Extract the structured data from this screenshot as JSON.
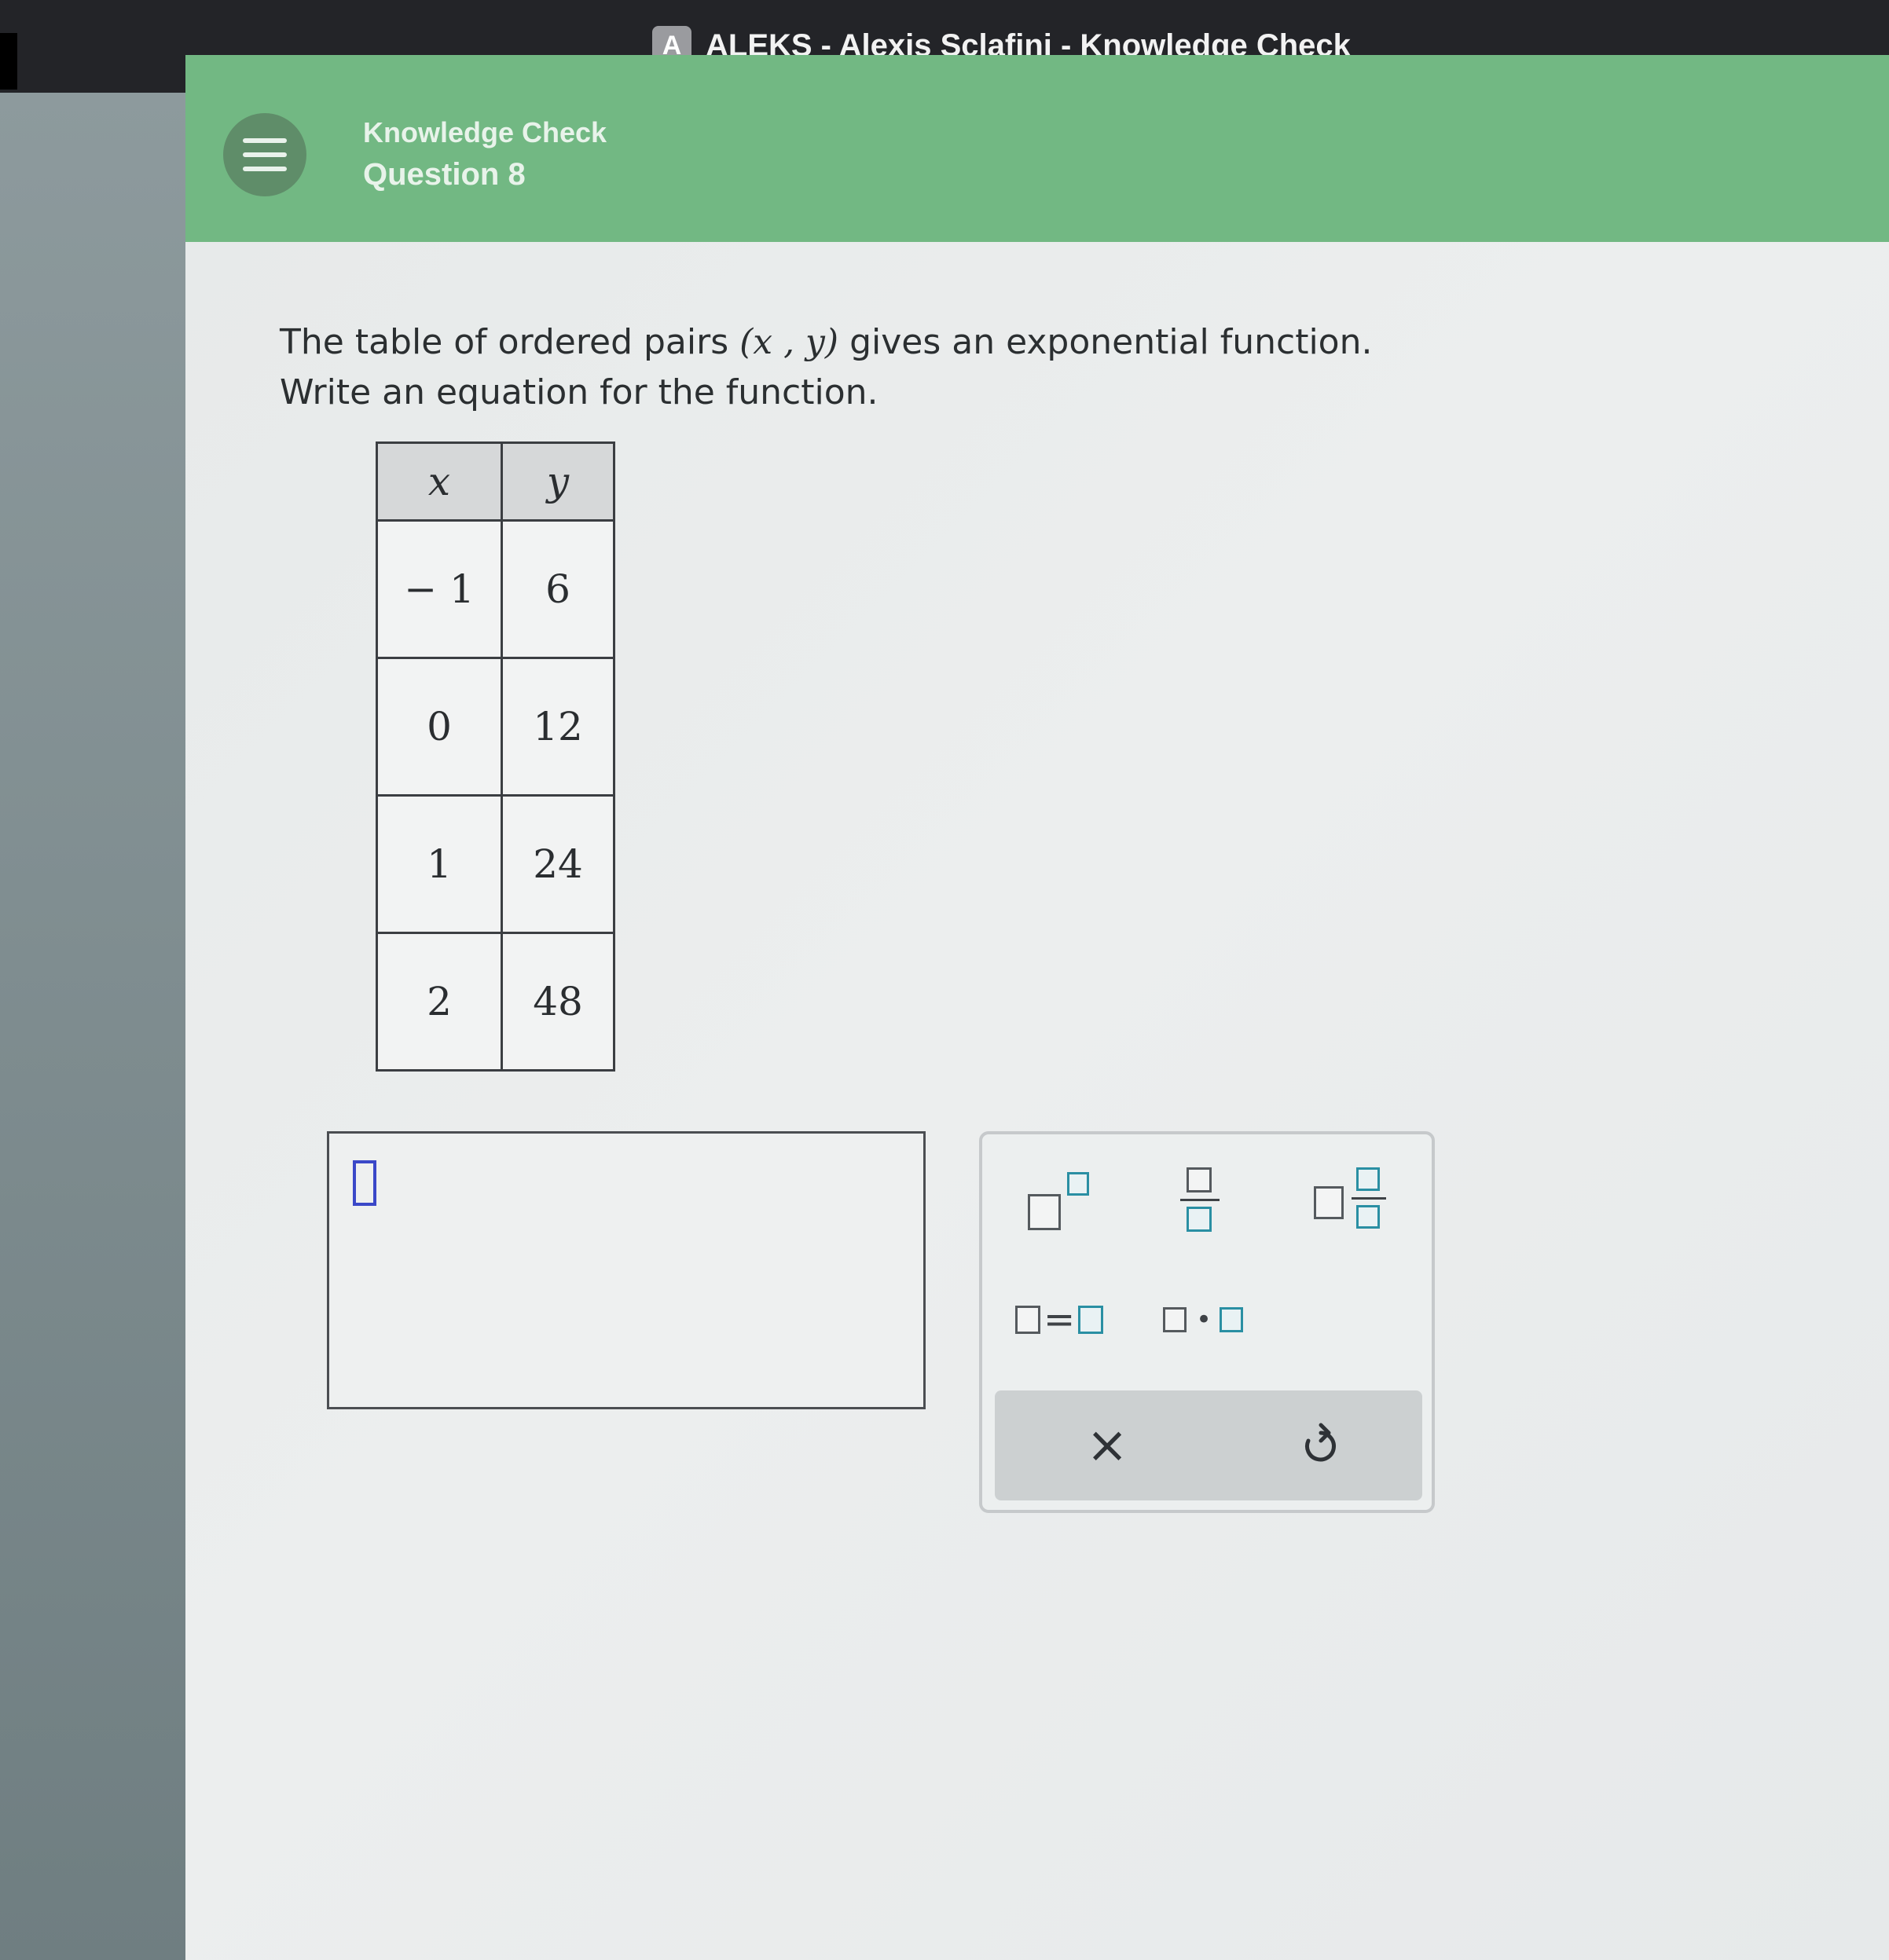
{
  "window": {
    "app_badge": "A",
    "title": "ALEKS - Alexis Sclafini - Knowledge Check"
  },
  "header": {
    "section": "Knowledge Check",
    "question": "Question 8"
  },
  "question": {
    "line1_before": "The table of ordered pairs ",
    "line1_math": "(x , y)",
    "line1_after": " gives an exponential function.",
    "line2": "Write an equation for the function."
  },
  "table": {
    "headers": [
      "x",
      "y"
    ],
    "rows": [
      [
        "− 1",
        "6"
      ],
      [
        "0",
        "12"
      ],
      [
        "1",
        "24"
      ],
      [
        "2",
        "48"
      ]
    ]
  },
  "answer": {
    "value": ""
  },
  "palette": {
    "equals_symbol": "=",
    "dot_symbol": "•",
    "clear_symbol": "×"
  }
}
